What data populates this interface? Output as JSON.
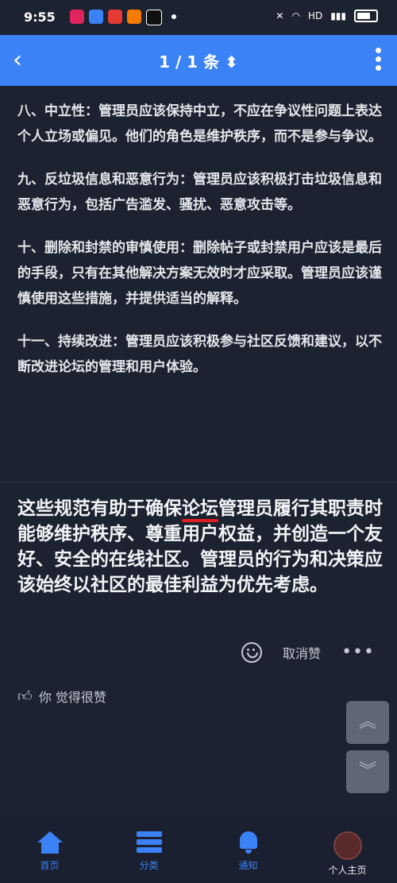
{
  "status": {
    "time": "9:55"
  },
  "header": {
    "title": "1 / 1 条 ⬍"
  },
  "paragraphs": [
    "八、中立性：管理员应该保持中立，不应在争议性问题上表达个人立场或偏见。他们的角色是维护秩序，而不是参与争议。",
    "九、反垃圾信息和恶意行为：管理员应该积极打击垃圾信息和恶意行为，包括广告滥发、骚扰、恶意攻击等。",
    "十、删除和封禁的审慎使用：删除帖子或封禁用户应该是最后的手段，只有在其他解决方案无效时才应采取。管理员应该谨慎使用这些措施，并提供适当的解释。",
    "十一、持续改进：管理员应该积极参与社区反馈和建议，以不断改进论坛的管理和用户体验。"
  ],
  "summary": {
    "before": "这些规范有助于确保",
    "highlight": "论坛",
    "after": "管理员履行其职责时能够维护秩序、尊重用户权益，并创造一个友好、安全的在线社区。管理员的行为和决策应该始终以社区的最佳利益为优先考虑。"
  },
  "actions": {
    "unlike_label": "取消赞",
    "more_label": "•••"
  },
  "liked_text": "你 觉得很赞",
  "scroll": {
    "up": "︽",
    "down": "︾"
  },
  "nav": [
    {
      "label": "首页"
    },
    {
      "label": "分类"
    },
    {
      "label": "通知"
    },
    {
      "label": "个人主页"
    }
  ]
}
